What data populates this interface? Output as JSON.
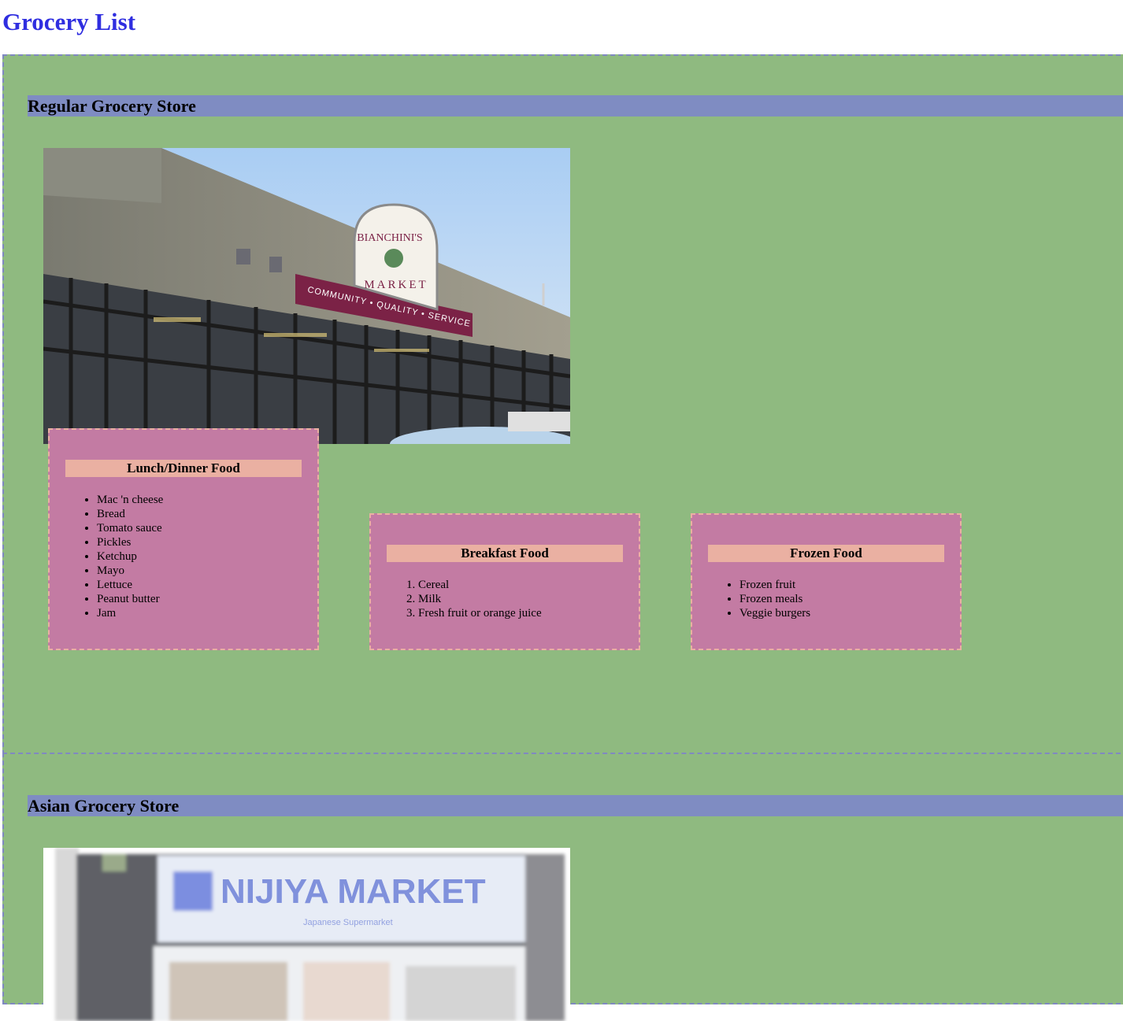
{
  "page": {
    "title": "Grocery List"
  },
  "stores": [
    {
      "heading": "Regular Grocery Store",
      "sign_name": "BIANCHINI'S",
      "sign_sub": "MARKET",
      "sign_banner": "COMMUNITY • QUALITY • SERVICE",
      "categories": [
        {
          "heading": "Lunch/Dinner Food",
          "list_type": "bulleted",
          "items": [
            "Mac 'n cheese",
            "Bread",
            "Tomato sauce",
            "Pickles",
            "Ketchup",
            "Mayo",
            "Lettuce",
            "Peanut butter",
            "Jam"
          ]
        },
        {
          "heading": "Breakfast Food",
          "list_type": "numbered",
          "items": [
            "Cereal",
            "Milk",
            "Fresh fruit or orange juice"
          ]
        },
        {
          "heading": "Frozen Food",
          "list_type": "bulleted",
          "items": [
            "Frozen fruit",
            "Frozen meals",
            "Veggie burgers"
          ]
        }
      ]
    },
    {
      "heading": "Asian Grocery Store",
      "sign_name": "NIJIYA MARKET",
      "sign_sub": "Japanese Supermarket"
    }
  ],
  "colors": {
    "title": "#2f2ee0",
    "store_bg": "#8fba80",
    "store_heading_bg": "#7f8cc2",
    "category_bg": "#c37ba3",
    "category_heading_bg": "#eab0a2"
  }
}
